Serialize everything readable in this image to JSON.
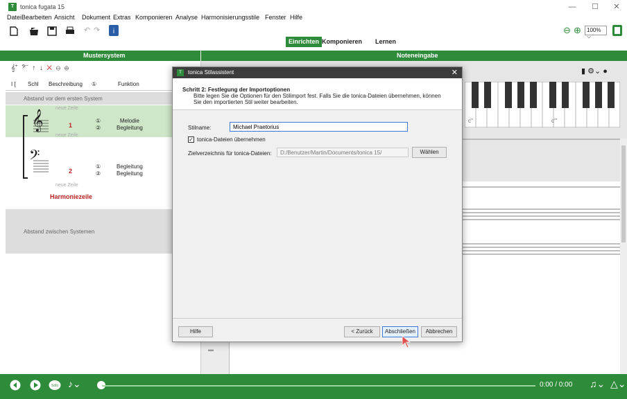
{
  "window": {
    "title": "tonica fugata 15",
    "logo": "T"
  },
  "menu": [
    "Datei",
    "Bearbeiten",
    "Ansicht",
    "Dokument",
    "Extras",
    "Komponieren",
    "Analyse",
    "Harmonisierungsstile",
    "Fenster",
    "Hilfe"
  ],
  "toolbar": {
    "modes": [
      "Einrichten",
      "Komponieren",
      "Lernen"
    ],
    "zoom": "100%"
  },
  "panels": {
    "left_title": "Mustersystem",
    "right_title": "Noteneingabe"
  },
  "columns": [
    "Schl",
    "Beschreibung",
    "Funktion"
  ],
  "left": {
    "abstand_oben": "Abstand vor dem ersten System",
    "neue_zeile": "neue Zeile",
    "row1_num": "1",
    "row1_func1": "Melodie",
    "row1_func2": "Begleitung",
    "row2_num": "2",
    "row2_func1": "Begleitung",
    "row2_func2": "Begleitung",
    "harmoniezeile": "Harmoniezeile",
    "abstand_zwischen": "Abstand zwischen Systemen"
  },
  "piano": {
    "labels": [
      "c''",
      "c'''"
    ]
  },
  "player": {
    "time": "0:00 / 0:00"
  },
  "dialog": {
    "title": "tonica Stilassistent",
    "step_title": "Schritt 2: Festlegung der Importoptionen",
    "step_desc": "Bitte legen Sie die Optionen für den Stilimport fest. Falls Sie die tonica-Dateien übernehmen, können Sie den importierten Stil weiter bearbeiten.",
    "stilname_label": "Stilname:",
    "stilname_value": "Michael Praetorius",
    "checkbox_label": "tonica-Dateien übernehmen",
    "ziel_label": "Zielverzeichnis für tonica-Dateien:",
    "ziel_value": "D:/Benutzer/Martin/Documents/tonica 15/",
    "waehlen": "Wählen",
    "hilfe": "Hilfe",
    "zurueck": "< Zurück",
    "abschliessen": "Abschließen",
    "abbrechen": "Abbrechen"
  },
  "colors": {
    "green": "#2e8b3a",
    "accent_blue": "#3b78d8"
  }
}
